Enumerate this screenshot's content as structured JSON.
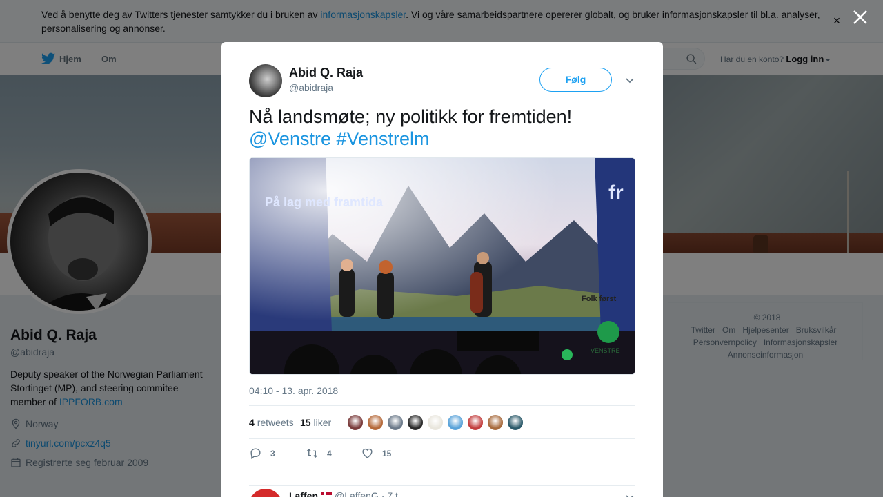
{
  "cookie_banner": {
    "text_before": "Ved å benytte deg av Twitters tjenester samtykker du i bruken av ",
    "link": "informasjonskapsler",
    "text_after": ". Vi og våre samarbeidspartnere opererer globalt, og bruker informasjonskapsler til bl.a. analyser, personalisering og annonser.",
    "close_label": "×"
  },
  "topnav": {
    "home_label": "Hjem",
    "about_label": "Om",
    "account_prompt": "Har du en konto?",
    "login_label": "Logg inn"
  },
  "profile": {
    "name": "Abid Q. Raja",
    "handle": "@abidraja",
    "bio_text": "Deputy speaker of the Norwegian Parliament Stortinget (MP), and steering commitee member of ",
    "bio_link": "IPPFORB.com",
    "location": "Norway",
    "website": "tinyurl.com/pcxz4q5",
    "joined": "Registrerte seg februar 2009"
  },
  "footer": {
    "copyright": "© 2018 Twitter",
    "links": [
      "Om",
      "Hjelpesenter",
      "Bruksvilkår",
      "Personvernpolicy",
      "Informasjonskapsler",
      "Annonseinformasjon"
    ]
  },
  "modal": {
    "author_name": "Abid Q. Raja",
    "author_handle": "@abidraja",
    "follow_label": "Følg",
    "tweet_text": "Nå landsmøte; ny politikk for fremtiden!",
    "tweet_mention": "@Venstre",
    "tweet_hashtag": "#Venstrelm",
    "media": {
      "banner_left": "På lag med framtida",
      "banner_right": "fr",
      "screen_text": "Folk først",
      "logo_text": "VENSTRE"
    },
    "timestamp": "04:10 - 13. apr. 2018",
    "retweets_count": "4",
    "retweets_label": "retweets",
    "likes_count": "15",
    "likes_label": "liker",
    "liker_colors": [
      "#7a3b3b",
      "#b5693a",
      "#6c7a8a",
      "#2b2b2b",
      "#e9e6dd",
      "#5aa3d9",
      "#c33f3f",
      "#a86b3e",
      "#2c5a6a"
    ],
    "actions": {
      "replies": "3",
      "retweets": "4",
      "likes": "15"
    },
    "reply": {
      "name": "Laffen",
      "handle": "@LaffenG",
      "time": "· 7 t"
    }
  }
}
